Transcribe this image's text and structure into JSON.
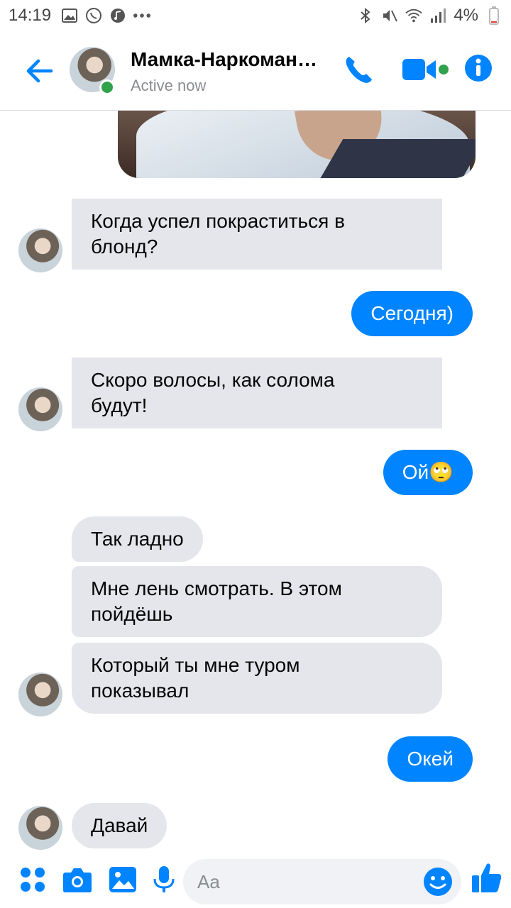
{
  "status_bar": {
    "time": "14:19",
    "battery": "4%",
    "left_icons": [
      "image-icon",
      "whatsapp-icon",
      "music-icon",
      "more-dots-icon"
    ],
    "right_icons": [
      "bluetooth-icon",
      "mute-icon",
      "wifi-icon",
      "signal-icon",
      "battery-icon"
    ]
  },
  "header": {
    "contact_name": "Мамка-Наркоман…",
    "status": "Active now",
    "accent": "#0084ff",
    "online_color": "#31a24c"
  },
  "messages": [
    {
      "side": "in",
      "text_lines": [
        "Когда успел покраститься в",
        "блонд?"
      ],
      "avatar": true
    },
    {
      "side": "out",
      "text_lines": [
        "Сегодня)"
      ]
    },
    {
      "side": "in",
      "text_lines": [
        "Скоро волосы, как солома",
        "будут!"
      ],
      "avatar": true
    },
    {
      "side": "out",
      "text_lines": [
        "Ой🙄"
      ]
    },
    {
      "side": "in",
      "text_lines": [
        "Так ладно"
      ],
      "avatar": false
    },
    {
      "side": "in",
      "text_lines": [
        "Мне лень смотрать. В этом",
        "пойдёшь"
      ],
      "avatar": false
    },
    {
      "side": "in",
      "text_lines": [
        "Который ты мне туром",
        "показывал"
      ],
      "avatar": true
    },
    {
      "side": "out",
      "text_lines": [
        "Окей"
      ]
    },
    {
      "side": "in",
      "text_lines": [
        "Давай"
      ],
      "avatar": true
    }
  ],
  "composer": {
    "placeholder": "Aa",
    "icons": [
      "apps-icon",
      "camera-icon",
      "gallery-icon",
      "microphone-icon",
      "emoji-icon",
      "like-icon"
    ]
  }
}
